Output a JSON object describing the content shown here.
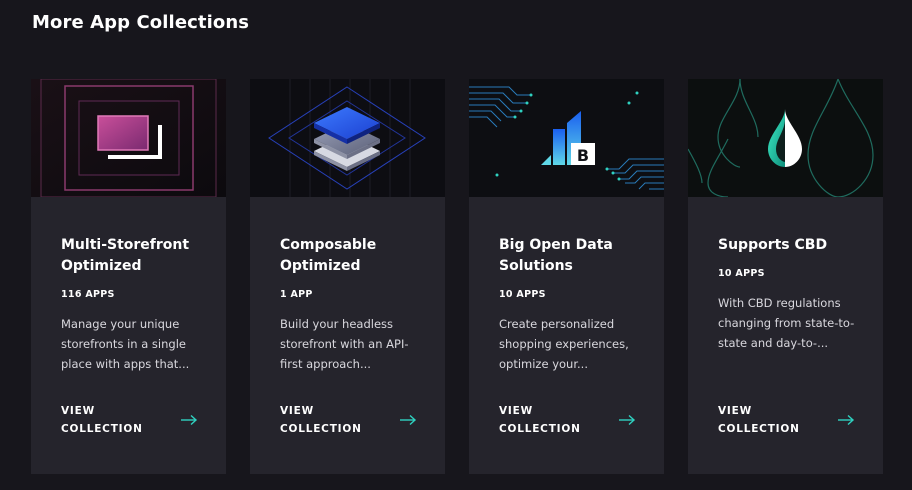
{
  "section": {
    "title": "More App Collections"
  },
  "accent_color": "#2fd1c0",
  "cards": [
    {
      "title": "Multi-Storefront Optimized",
      "count": "116 APPS",
      "description": "Manage your unique storefronts in a single place with apps that...",
      "cta": "VIEW COLLECTION",
      "image_icon": "storefront-frames-icon"
    },
    {
      "title": "Composable Optimized",
      "count": "1 APP",
      "description": "Build your headless storefront with an API-first approach...",
      "cta": "VIEW COLLECTION",
      "image_icon": "layers-stack-icon"
    },
    {
      "title": "Big Open Data Solutions",
      "count": "10 APPS",
      "description": "Create personalized shopping experiences, optimize your...",
      "cta": "VIEW COLLECTION",
      "image_icon": "data-bars-logo-icon"
    },
    {
      "title": "Supports CBD",
      "count": "10 APPS",
      "description": "With CBD regulations changing from state-to-state and day-to-...",
      "cta": "VIEW COLLECTION",
      "image_icon": "cbd-droplet-icon"
    }
  ]
}
